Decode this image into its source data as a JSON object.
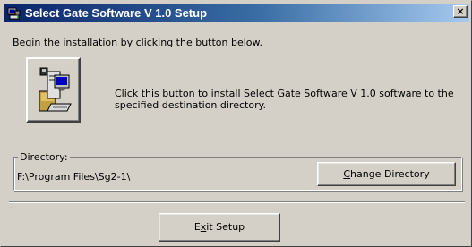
{
  "window": {
    "title": "Select Gate Software V 1.0 Setup",
    "close_glyph": "×"
  },
  "intro": {
    "text": "Begin the installation by clicking the button below."
  },
  "install": {
    "icon": "computer-install-icon",
    "description": "Click this button to install Select Gate Software V 1.0 software to the specified destination directory."
  },
  "directory": {
    "label": "Directory:",
    "path": "F:\\Program Files\\Sg2-1\\",
    "change_label_pre": "",
    "change_label_mnemonic": "C",
    "change_label_post": "hange Directory"
  },
  "exit": {
    "label_pre": "E",
    "label_mnemonic": "x",
    "label_post": "it Setup"
  },
  "colors": {
    "title_gradient_start": "#0a246a",
    "title_gradient_end": "#a6caf0",
    "face": "#d4d0c8"
  }
}
